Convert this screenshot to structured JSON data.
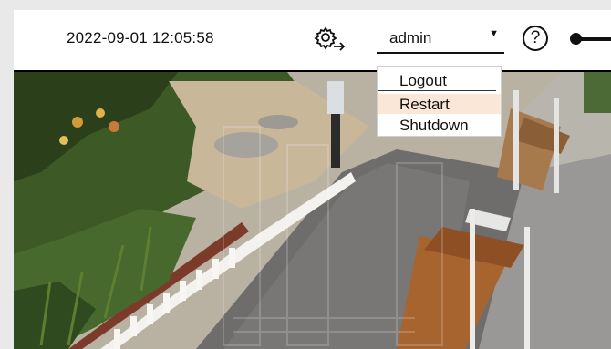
{
  "header": {
    "datetime": "2022-09-01 12:05:58",
    "settings_icon": "gear-arrow-icon",
    "user": "admin",
    "help_icon": "question-circle-icon",
    "logout_icon": "logout-key-icon"
  },
  "user_menu": {
    "items": [
      "Logout",
      "Restart",
      "Shutdown"
    ],
    "highlighted": "Restart",
    "highlight_color": "#fbe7d8"
  }
}
